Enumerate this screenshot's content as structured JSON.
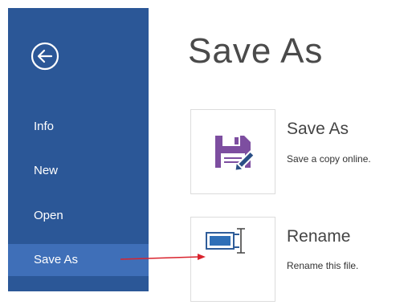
{
  "sidebar": {
    "back_icon": "back-arrow-circle-icon",
    "items": [
      {
        "label": "Info"
      },
      {
        "label": "New"
      },
      {
        "label": "Open"
      },
      {
        "label": "Save As",
        "selected": true
      }
    ],
    "bg_color": "#2b5797",
    "selected_color": "#3f6fb8"
  },
  "main": {
    "title": "Save As",
    "options": [
      {
        "title": "Save As",
        "description": "Save a copy online.",
        "icon": "save-as-floppy-pencil-icon"
      },
      {
        "title": "Rename",
        "description": "Rename this file.",
        "icon": "rename-textbox-cursor-icon"
      }
    ]
  },
  "annotation": {
    "color": "#d9232d"
  }
}
